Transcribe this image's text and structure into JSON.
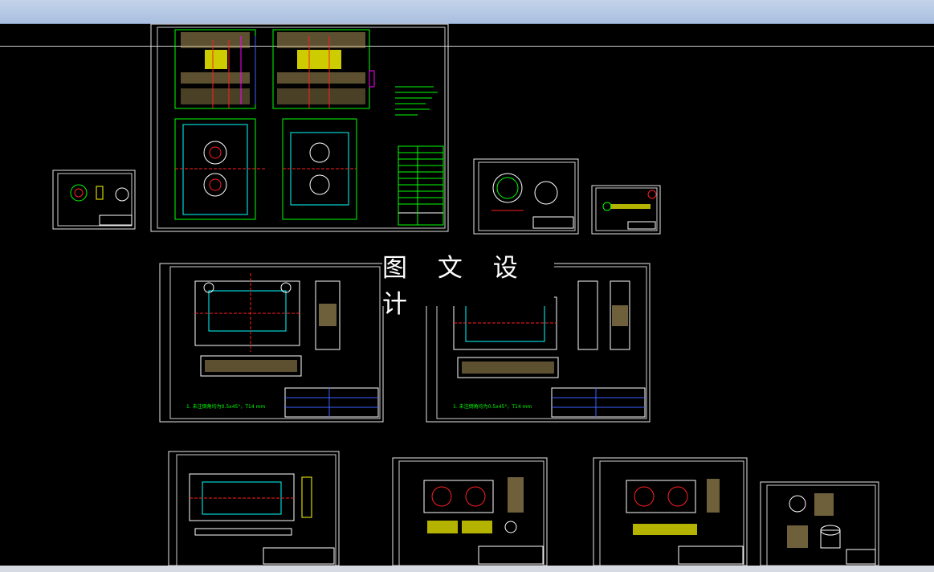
{
  "watermark": {
    "text": "图 文 设 计"
  },
  "sheets": [
    {
      "name": "assembly-drawing-sheet"
    },
    {
      "name": "small-part-sheet-left"
    },
    {
      "name": "part-sheet-ring"
    },
    {
      "name": "part-sheet-pin"
    },
    {
      "name": "plate-sheet-1"
    },
    {
      "name": "plate-sheet-2"
    },
    {
      "name": "plate-sheet-3"
    },
    {
      "name": "plate-sheet-4"
    },
    {
      "name": "plate-sheet-5"
    },
    {
      "name": "insert-sheet"
    }
  ],
  "notes": {
    "plate1_note": "1. 未注倒角均为0.5x45°，T14 mm",
    "plate2_note": "1. 未注倒角均为0.5x45°，T14 mm"
  },
  "colors": {
    "background": "#000000",
    "frame": "#e8e8e8",
    "green": "#00ff00",
    "red": "#ff2020",
    "cyan": "#00ffff",
    "yellow": "#ffff00",
    "magenta": "#ff00ff",
    "blue": "#4060ff"
  }
}
